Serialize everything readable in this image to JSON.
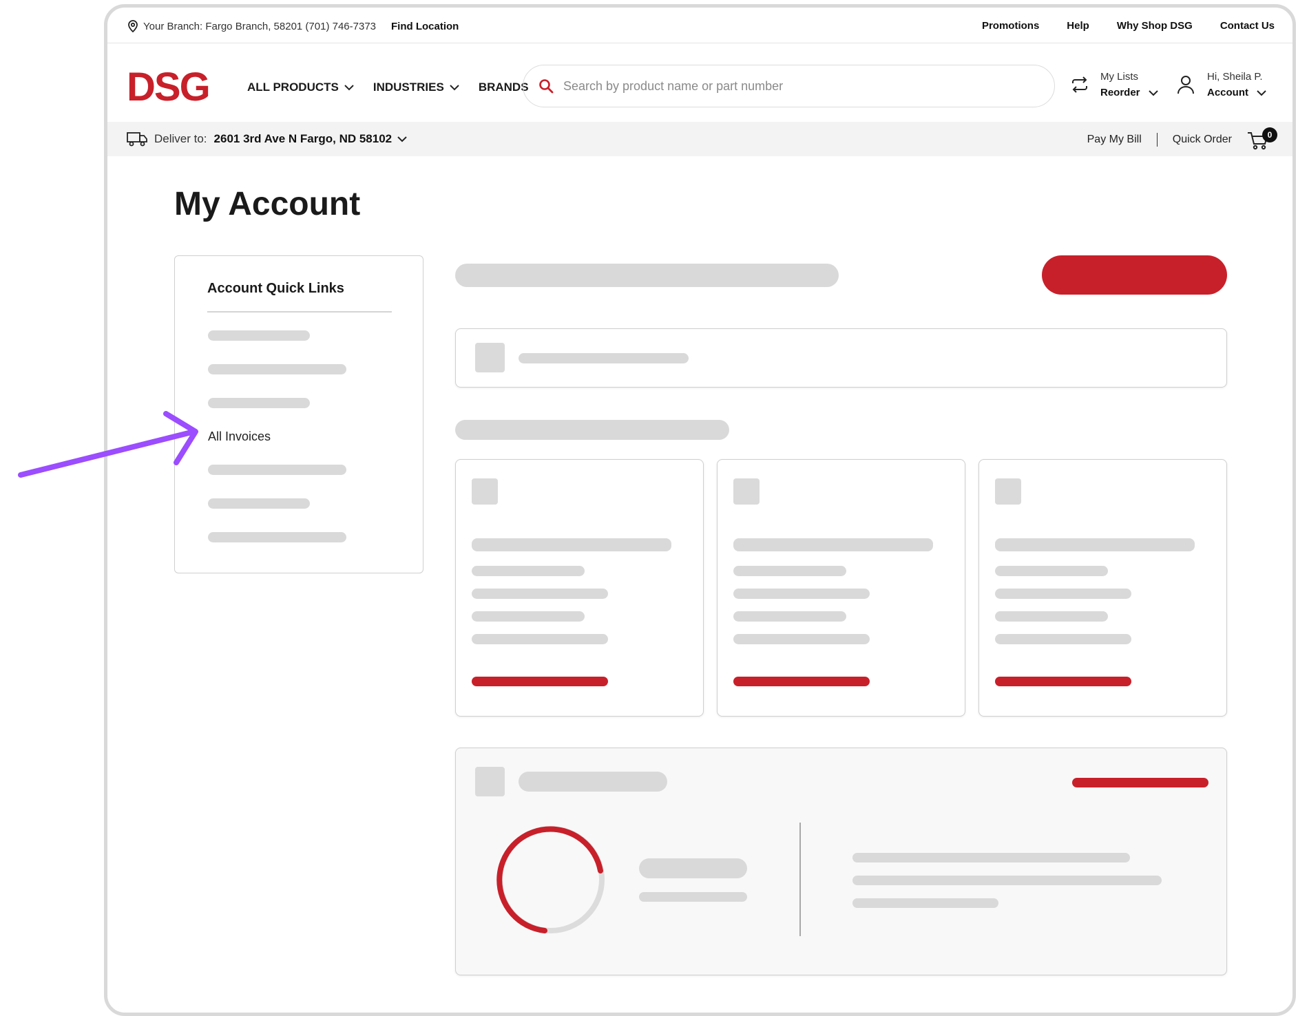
{
  "utility": {
    "branch": "Your Branch: Fargo Branch, 58201 (701) 746-7373",
    "find_location": "Find Location",
    "links": [
      "Promotions",
      "Help",
      "Why Shop DSG",
      "Contact Us"
    ]
  },
  "header": {
    "logo": "DSG",
    "nav": [
      "ALL PRODUCTS",
      "INDUSTRIES",
      "BRANDS"
    ],
    "search_placeholder": "Search by product name or part number",
    "lists_top": "My Lists",
    "lists_bottom": "Reorder",
    "account_top": "Hi, Sheila P.",
    "account_bottom": "Account"
  },
  "deliver": {
    "label": "Deliver to:",
    "address": "2601 3rd Ave N Fargo, ND 58102",
    "pay_bill": "Pay My Bill",
    "quick_order": "Quick Order",
    "cart_count": "0"
  },
  "page_title": "My Account",
  "quick_links": {
    "heading": "Account Quick Links",
    "highlighted_item": "All Invoices"
  },
  "colors": {
    "brand_red": "#c8202a",
    "skeleton": "#d9d9d9",
    "annotation_arrow": "#9b4dff"
  },
  "icons": [
    "location-pin-icon",
    "chevron-down-icon",
    "search-icon",
    "reorder-icon",
    "user-icon",
    "truck-icon",
    "cart-icon",
    "donut-progress-icon"
  ]
}
